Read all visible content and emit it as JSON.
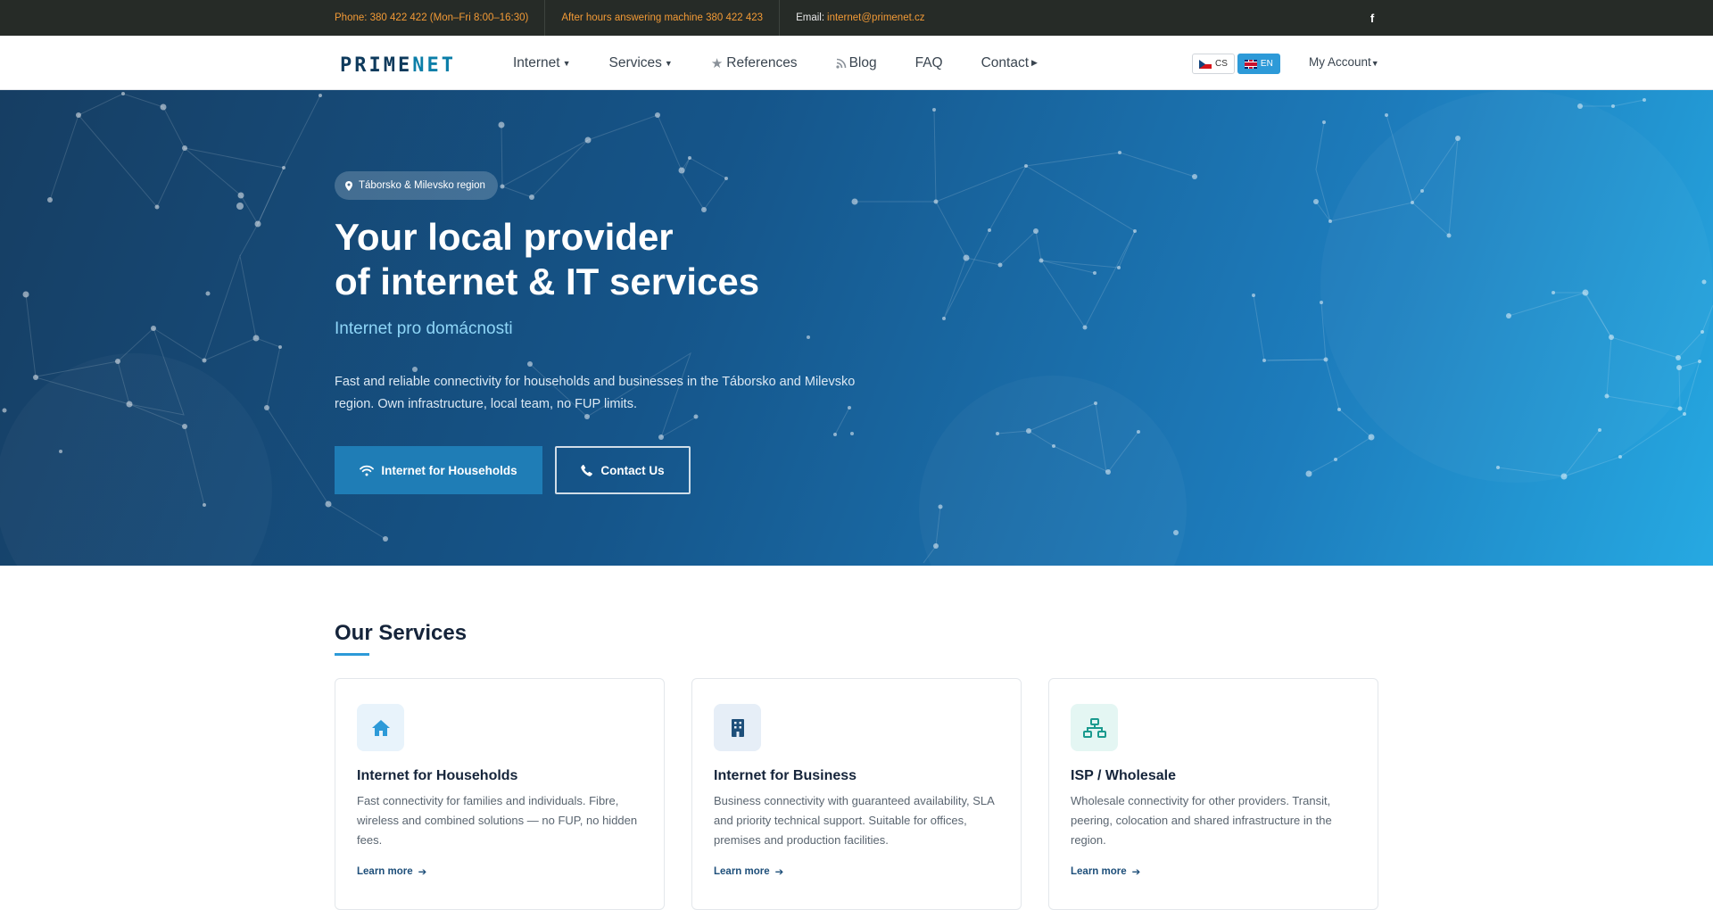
{
  "topbar": {
    "phone": "Phone: 380 422 422 (Mon–Fri 8:00–16:30)",
    "after_hours": "After hours answering machine 380 422 423",
    "email_label": "Email:",
    "email": "internet@primenet.cz",
    "facebook_icon": "facebook-icon"
  },
  "nav": {
    "logo": {
      "part1": "PRIME",
      "part2": "NET"
    },
    "items": [
      {
        "label": "Internet"
      },
      {
        "label": "Services"
      },
      {
        "label": "References"
      },
      {
        "label": "Blog"
      },
      {
        "label": "FAQ"
      },
      {
        "label": "Contact"
      }
    ],
    "lang": {
      "cs": "CS",
      "en": "EN",
      "active": "EN"
    },
    "account": "My Account"
  },
  "hero": {
    "badge": "Táborsko & Milevsko region",
    "title_line1": "Your local provider",
    "title_line2": "of internet & IT services",
    "subtitle": "Internet pro domácnosti",
    "description": "Fast and reliable connectivity for households and businesses in the Táborsko and Milevsko region. Own infrastructure, local team, no FUP limits.",
    "btn_primary": "Internet for Households",
    "btn_secondary": "Contact Us"
  },
  "services": {
    "heading": "Our Services",
    "cards": [
      {
        "title": "Internet for Households",
        "text": "Fast connectivity for families and individuals. Fibre, wireless and combined solutions — no FUP, no hidden fees.",
        "link": "Learn more",
        "icon": "home-icon"
      },
      {
        "title": "Internet for Business",
        "text": "Business connectivity with guaranteed availability, SLA and priority technical support. Suitable for offices, premises and production facilities.",
        "link": "Learn more",
        "icon": "building-icon"
      },
      {
        "title": "ISP / Wholesale",
        "text": "Wholesale connectivity for other providers. Transit, peering, colocation and shared infrastructure in the region.",
        "link": "Learn more",
        "icon": "network-icon"
      }
    ]
  },
  "colors": {
    "topbar_bg": "#262b27",
    "topbar_accent": "#f29a36",
    "primary": "#1f7db6",
    "accent": "#2d9ad8",
    "heading": "#15243a"
  }
}
